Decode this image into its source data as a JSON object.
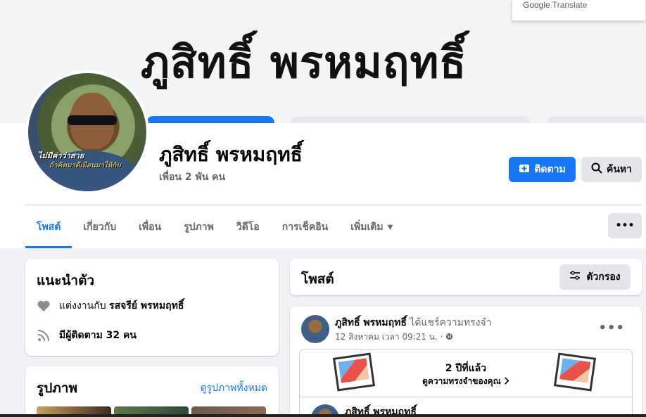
{
  "google_translate": {
    "brand": "Google",
    "label": "Translate"
  },
  "cover": {
    "name_text": "ภูสิทธิ์ พรหมฤทธิ์"
  },
  "profile": {
    "name": "ภูสิทธิ์ พรหมฤทธิ์",
    "friends": "เพื่อน 2 พัน คน",
    "avatar_caption_1": "ไม่มีค่าว่าสาย",
    "avatar_caption_2": "ถ้าคิดมาดีเยือนมาให้กับ"
  },
  "actions": {
    "follow": "ติดตาม",
    "search": "ค้นหา",
    "more": "•••"
  },
  "tabs": [
    {
      "label": "โพสต์"
    },
    {
      "label": "เกี่ยวกับ"
    },
    {
      "label": "เพื่อน"
    },
    {
      "label": "รูปภาพ"
    },
    {
      "label": "วิดีโอ"
    },
    {
      "label": "การเช็คอิน"
    },
    {
      "label": "เพิ่มเติม"
    }
  ],
  "intro": {
    "title": "แนะนำตัว",
    "married_prefix": "แต่งงานกับ",
    "married_name": "รสจรีย์ พรหมฤทธิ์",
    "followers": "มีผู้ติดตาม 32 คน"
  },
  "photos": {
    "title": "รูปภาพ",
    "see_all": "ดูรูปภาพทั้งหมด"
  },
  "posts": {
    "title": "โพสต์",
    "filter": "ตัวกรอง"
  },
  "post": {
    "author": "ภูสิทธิ์ พรหมฤทธิ์",
    "action": "ได้แชร์ความทรงจำ",
    "time": "12 สิงหาคม เวลา 09:21 น. ·",
    "menu": "•••",
    "memory_years": "2 ปีที่แล้ว",
    "memory_link": "ดูความทรงจำของคุณ"
  },
  "post2": {
    "author": "ภูสิทธิ์ พรหมฤทธิ์"
  },
  "colors": {
    "accent": "#1877f2",
    "background": "#f0f2f5",
    "secondary_text": "#65676b"
  }
}
